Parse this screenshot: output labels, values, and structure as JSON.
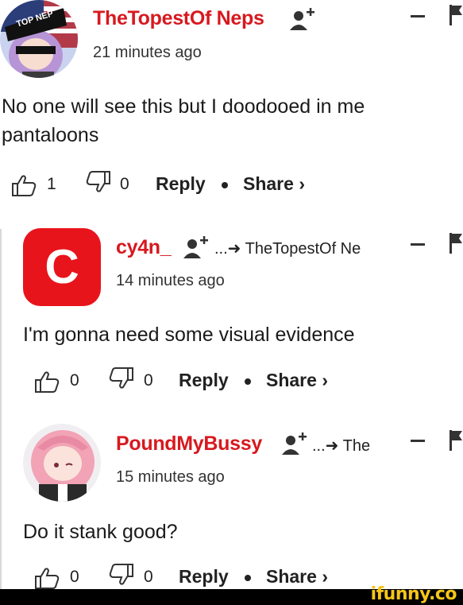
{
  "comments": [
    {
      "username": "TheTopestOf Neps",
      "time": "21 minutes ago",
      "text": "No one will see this but I doodooed in me pantaloons",
      "likes": "1",
      "dislikes": "0",
      "reply_label": "Reply",
      "share_label": "Share ›",
      "avatar_text": "TOP NEP"
    },
    {
      "username": "cy4n_",
      "reply_to": "...➜ TheTopestOf Ne",
      "time": "14 minutes ago",
      "text": "I'm gonna need some visual evidence",
      "likes": "0",
      "dislikes": "0",
      "reply_label": "Reply",
      "share_label": "Share ›",
      "avatar_letter": "C"
    },
    {
      "username": "PoundMyBussy",
      "reply_to": "...➜ The",
      "time": "15 minutes ago",
      "text": "Do it stank good?",
      "likes": "0",
      "dislikes": "0",
      "reply_label": "Reply",
      "share_label": "Share ›"
    }
  ],
  "footer": {
    "brand": "ifunny.co"
  },
  "colors": {
    "username": "#d7191f",
    "avatar_red": "#e8141b",
    "footer_bg": "#000000",
    "brand": "#f5c518"
  }
}
